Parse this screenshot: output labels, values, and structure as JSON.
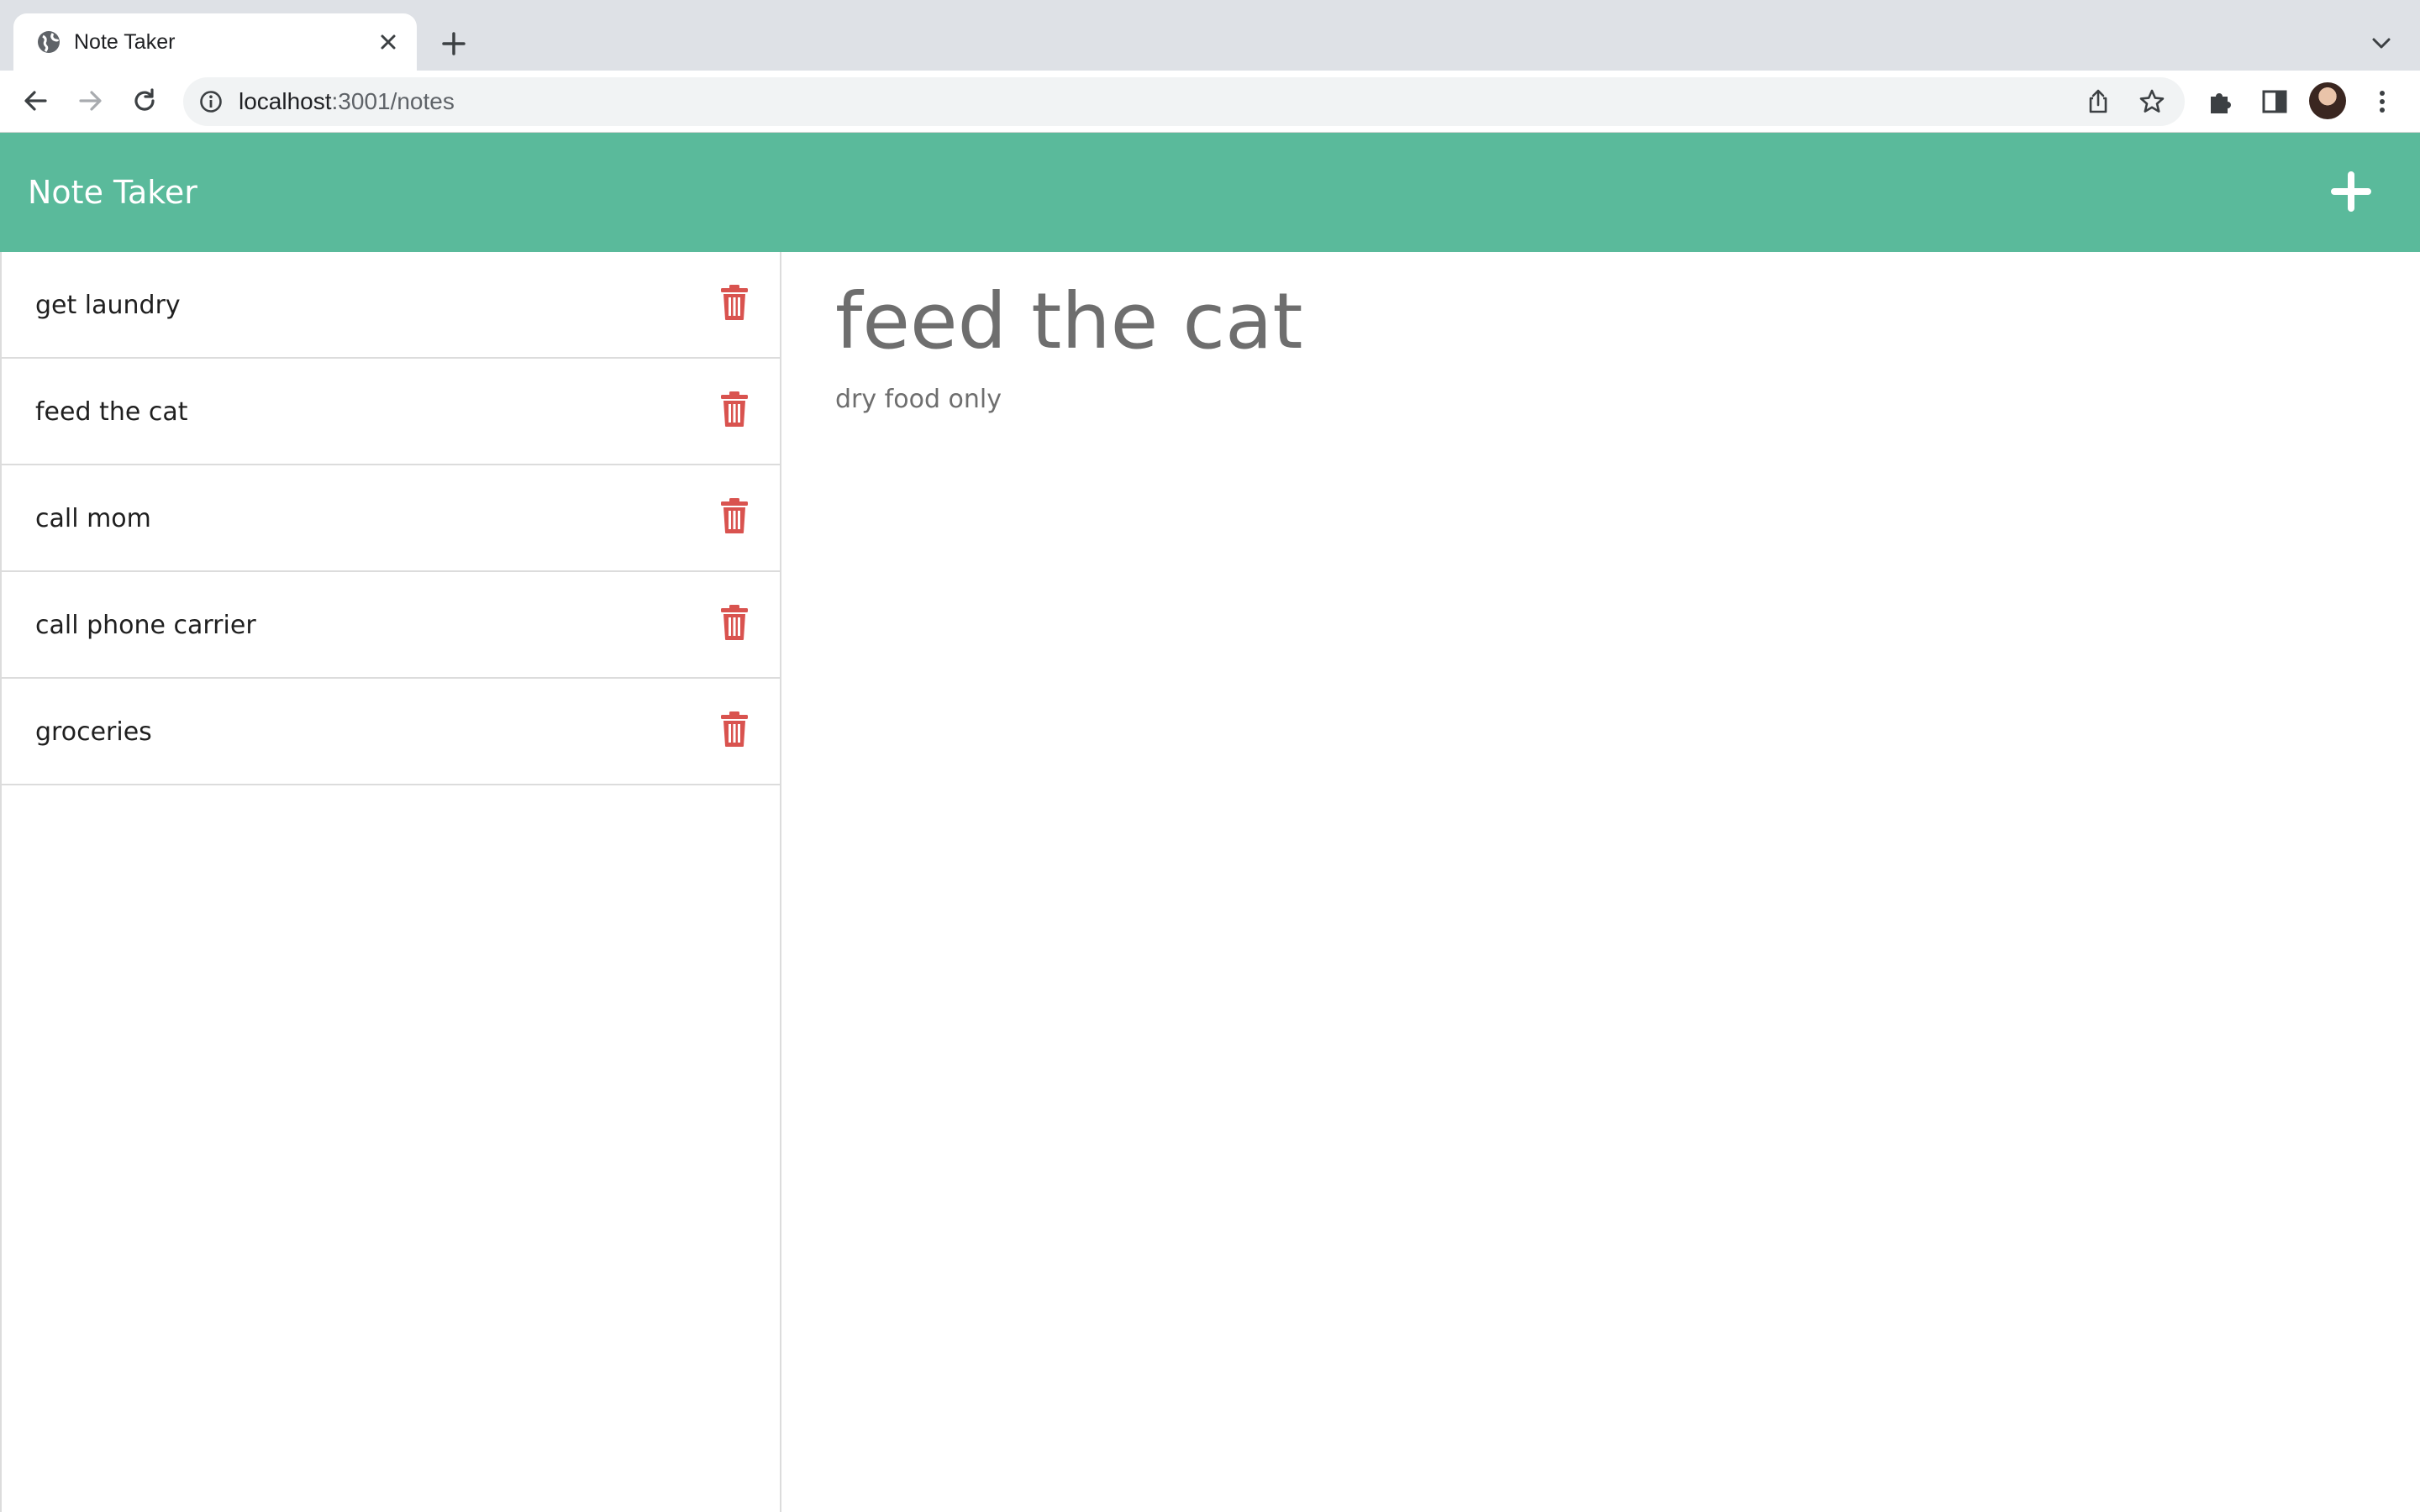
{
  "browser": {
    "tab": {
      "title": "Note Taker",
      "favicon": "globe-icon"
    },
    "address_bar": {
      "host": "localhost",
      "path": ":3001/notes"
    }
  },
  "app": {
    "title": "Note Taker",
    "header_color": "#5aba9b",
    "add_icon": "plus-icon"
  },
  "notes": [
    {
      "title": "get laundry"
    },
    {
      "title": "feed the cat"
    },
    {
      "title": "call mom"
    },
    {
      "title": "call phone carrier"
    },
    {
      "title": "groceries"
    }
  ],
  "delete_icon": "trash-icon",
  "delete_color": "#d9534f",
  "active_note": {
    "title": "feed the cat",
    "text": "dry food only"
  }
}
